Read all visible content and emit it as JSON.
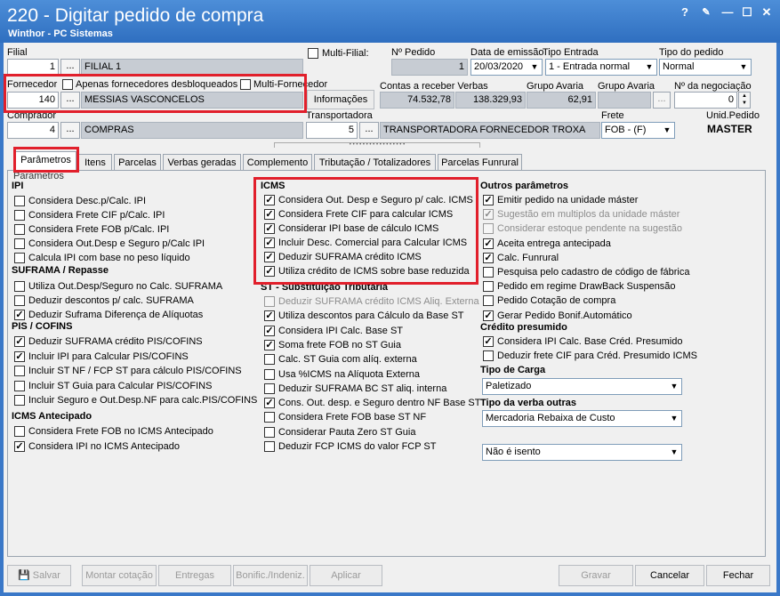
{
  "window": {
    "title": "220 - Digitar pedido de compra",
    "subtitle": "Winthor - PC Sistemas"
  },
  "header": {
    "filial_label": "Filial",
    "filial_code": "1",
    "filial_name": "FILIAL 1",
    "multi_filial": "Multi-Filial:",
    "nr_pedido_label": "Nº Pedido",
    "nr_pedido": "1",
    "data_emissao_label": "Data de emissão",
    "data_emissao": "20/03/2020",
    "tipo_entrada_label": "Tipo Entrada",
    "tipo_entrada": "1 - Entrada normal",
    "tipo_pedido_label": "Tipo do pedido",
    "tipo_pedido": "Normal",
    "fornecedor_label": "Fornecedor",
    "apenas_desbloqueados": "Apenas fornecedores desbloqueados",
    "multi_fornecedor": "Multi-Fornecedor",
    "fornecedor_code": "140",
    "fornecedor_name": "MESSIAS VASCONCELOS",
    "informacoes": "Informações",
    "contas_receber_label": "Contas a receber Verbas",
    "contas_receber": "74.532,78",
    "verbas": "138.329,93",
    "grupo_avaria1_label": "Grupo Avaria",
    "grupo_avaria1": "62,91",
    "grupo_avaria2_label": "Grupo Avaria",
    "nr_negociacao_label": "Nº da negociação",
    "nr_negociacao": "0",
    "comprador_label": "Comprador",
    "comprador_code": "4",
    "comprador_name": "COMPRAS",
    "transportadora_label": "Transportadora",
    "transportadora_code": "5",
    "transportadora_name": "TRANSPORTADORA FORNECEDOR TROXA",
    "frete_label": "Frete",
    "frete": "FOB - (F)",
    "unid_pedido_label": "Unid.Pedido",
    "unid_pedido": "MASTER",
    "dots": "..."
  },
  "tabs": [
    "Parâmetros",
    "Itens",
    "Parcelas",
    "Verbas geradas",
    "Complemento",
    "Tributação / Totalizadores",
    "Parcelas Funrural"
  ],
  "panel_title": "Parametros",
  "col1": {
    "ipi_title": "IPI",
    "ipi": [
      {
        "label": "Considera Desc.p/Calc. IPI",
        "checked": false
      },
      {
        "label": "Considera Frete CIF p/Calc. IPI",
        "checked": false
      },
      {
        "label": "Considera Frete FOB p/Calc. IPI",
        "checked": false
      },
      {
        "label": "Considera Out.Desp e Seguro p/Calc IPI",
        "checked": false
      },
      {
        "label": "Calcula IPI com base no peso líquido",
        "checked": false
      }
    ],
    "suframa_title": "SUFRAMA / Repasse",
    "suframa": [
      {
        "label": "Utiliza Out.Desp/Seguro no Calc. SUFRAMA",
        "checked": false
      },
      {
        "label": "Deduzir descontos p/ calc. SUFRAMA",
        "checked": false
      },
      {
        "label": "Deduzir Suframa Diferença de Alíquotas",
        "checked": true
      }
    ],
    "pis_title": "PIS / COFINS",
    "pis": [
      {
        "label": "Deduzir SUFRAMA crédito PIS/COFINS",
        "checked": true
      },
      {
        "label": "Incluir IPI para Calcular PIS/COFINS",
        "checked": true
      },
      {
        "label": "Incluir ST NF / FCP ST para cálculo PIS/COFINS",
        "checked": false
      },
      {
        "label": "Incluir ST Guia para Calcular PIS/COFINS",
        "checked": false
      },
      {
        "label": "Incluir Seguro e Out.Desp.NF para calc.PIS/COFINS",
        "checked": false
      }
    ],
    "icmsant_title": "ICMS Antecipado",
    "icmsant": [
      {
        "label": "Considera Frete FOB no ICMS Antecipado",
        "checked": false
      },
      {
        "label": "Considera IPI no ICMS Antecipado",
        "checked": true
      }
    ]
  },
  "col2": {
    "icms_title": "ICMS",
    "icms": [
      {
        "label": "Considera Out. Desp e Seguro p/ calc. ICMS",
        "checked": true
      },
      {
        "label": "Considera Frete CIF para calcular ICMS",
        "checked": true
      },
      {
        "label": "Considerar IPI base de cálculo ICMS",
        "checked": true
      },
      {
        "label": "Incluir Desc. Comercial  para Calcular ICMS",
        "checked": true
      },
      {
        "label": "Deduzir SUFRAMA crédito ICMS",
        "checked": true
      },
      {
        "label": "Utiliza crédito de ICMS sobre base reduzida",
        "checked": true
      }
    ],
    "st_title": "ST - Substituição Tributária",
    "st": [
      {
        "label": "Deduzir SUFRAMA crédito ICMS Aliq. Externa",
        "checked": false,
        "disabled": true
      },
      {
        "label": "Utiliza descontos para Cálculo da Base ST",
        "checked": true
      },
      {
        "label": "Considera IPI Calc. Base ST",
        "checked": true
      },
      {
        "label": "Soma frete FOB no ST Guia",
        "checked": true
      },
      {
        "label": "Calc. ST Guia com alíq. externa",
        "checked": false
      },
      {
        "label": "Usa %ICMS na Alíquota Externa",
        "checked": false
      },
      {
        "label": "Deduzir SUFRAMA BC ST aliq. interna",
        "checked": false
      },
      {
        "label": "Cons. Out. desp. e Seguro dentro NF Base ST",
        "checked": true
      },
      {
        "label": "Considera Frete FOB base ST NF",
        "checked": false
      },
      {
        "label": "Considerar Pauta Zero ST Guia",
        "checked": false
      },
      {
        "label": "Deduzir FCP ICMS do valor FCP ST",
        "checked": false
      }
    ]
  },
  "col3": {
    "outros_title": "Outros parâmetros",
    "outros": [
      {
        "label": "Emitir pedido na unidade máster",
        "checked": true
      },
      {
        "label": "Sugestão em multiplos da unidade máster",
        "checked": true,
        "disabled": true
      },
      {
        "label": "Considerar estoque pendente na sugestão",
        "checked": false,
        "disabled": true
      },
      {
        "label": "Aceita entrega antecipada",
        "checked": true
      },
      {
        "label": "Calc. Funrural",
        "checked": true
      },
      {
        "label": "Pesquisa pelo cadastro de código de fábrica",
        "checked": false
      },
      {
        "label": "Pedido em regime DrawBack Suspensão",
        "checked": false
      },
      {
        "label": "Pedido Cotação de compra",
        "checked": false
      },
      {
        "label": "Gerar Pedido Bonif.Automático",
        "checked": true
      }
    ],
    "credito_title": "Crédito presumido",
    "credito": [
      {
        "label": "Considera IPI Calc. Base Créd. Presumido",
        "checked": true
      },
      {
        "label": "Deduzir frete CIF para Créd. Presumido ICMS",
        "checked": false
      }
    ],
    "tipo_carga_title": "Tipo de Carga",
    "tipo_carga": "Paletizado",
    "tipo_verba_title": "Tipo da verba outras",
    "tipo_verba": "Mercadoria Rebaixa de Custo",
    "isento": "Não é isento"
  },
  "buttons": {
    "salvar": "Salvar",
    "montar": "Montar cotação",
    "entregas": "Entregas",
    "bonific": "Bonific./Indeniz.",
    "aplicar": "Aplicar",
    "gravar": "Gravar",
    "cancelar": "Cancelar",
    "fechar": "Fechar"
  },
  "colors": {
    "titlebar": "#3a78c8",
    "highlight": "#e11f2b",
    "readonly": "#c7ccd3"
  }
}
